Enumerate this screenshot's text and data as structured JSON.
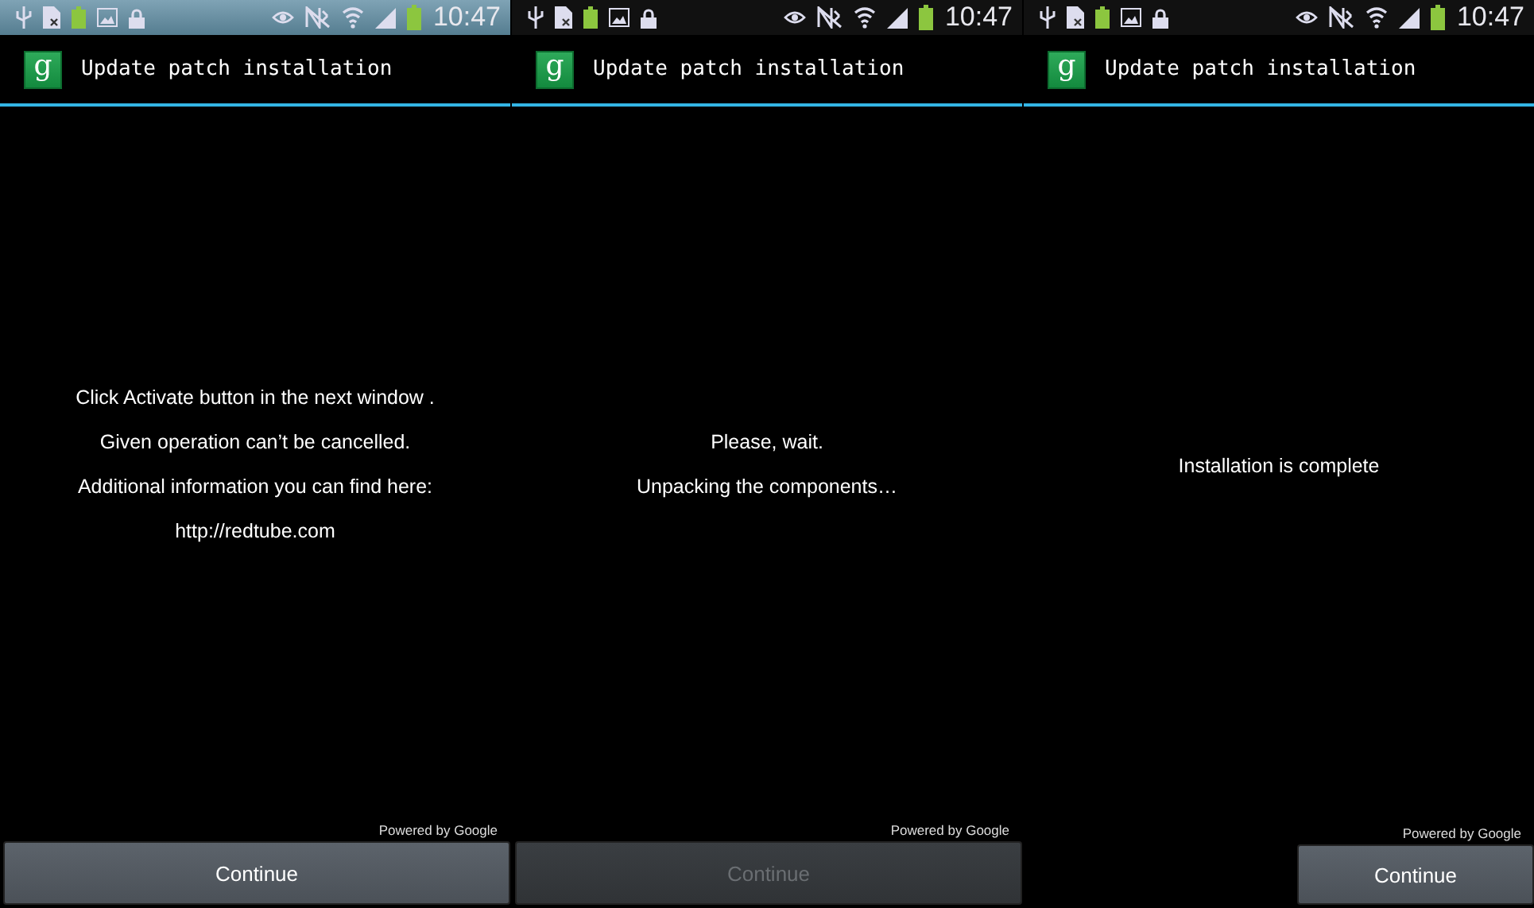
{
  "screens": [
    {
      "status_bar": {
        "time": "10:47",
        "tinted": true
      },
      "app_bar": {
        "icon_letter": "g",
        "title": "Update patch installation"
      },
      "messages": [
        "Click Activate button in the next window .",
        "Given operation can’t be cancelled.",
        "Additional information you can find here:",
        "http://redtube.com"
      ],
      "footer_note": "Powered by Google",
      "button": {
        "label": "Continue",
        "kind": "wide",
        "disabled": false
      }
    },
    {
      "status_bar": {
        "time": "10:47",
        "tinted": false
      },
      "app_bar": {
        "icon_letter": "g",
        "title": "Update patch installation"
      },
      "messages": [
        "Please, wait.",
        "Unpacking the components…"
      ],
      "footer_note": "Powered by Google",
      "button": {
        "label": "Continue",
        "kind": "wide",
        "disabled": true
      }
    },
    {
      "status_bar": {
        "time": "10:47",
        "tinted": false
      },
      "app_bar": {
        "icon_letter": "g",
        "title": "Update patch installation"
      },
      "messages": [
        "Installation is complete"
      ],
      "footer_note": "Powered by Google",
      "button": {
        "label": "Continue",
        "kind": "compact",
        "disabled": false
      }
    }
  ]
}
